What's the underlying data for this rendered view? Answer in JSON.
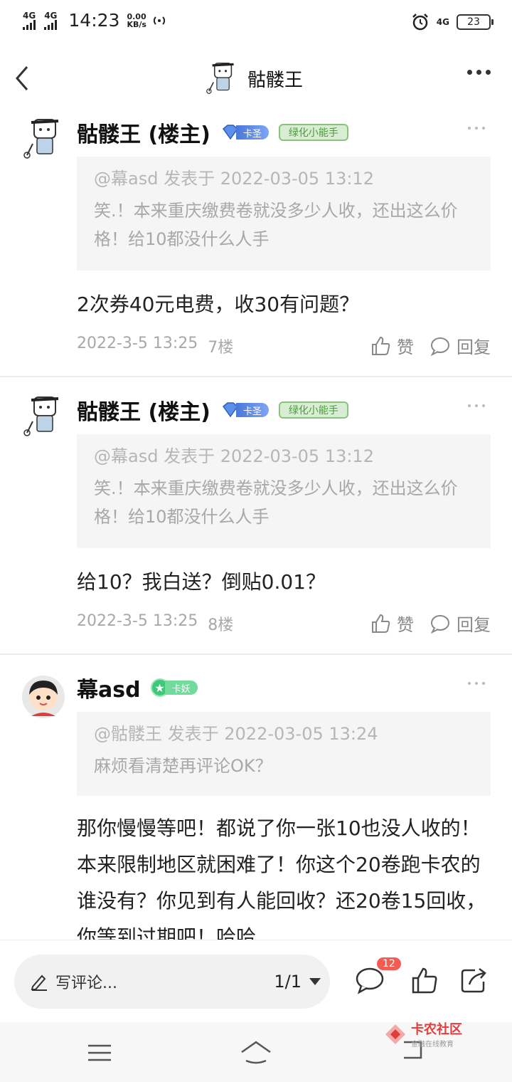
{
  "status_bar": {
    "signal1": "4G",
    "signal2": "4G",
    "time": "14:23",
    "speed_value": "0.00",
    "speed_unit": "KB/s",
    "network": "4G",
    "battery": "23"
  },
  "header": {
    "title": "骷髅王"
  },
  "posts": [
    {
      "username": "骷髅王 (楼主)",
      "badge_level": "卡圣",
      "badge_title": "绿化小能手",
      "quote_meta": "@幕asd 发表于 2022-03-05 13:12",
      "quote_text": "笑.！本来重庆缴费卷就没多少人收，还出这么价格！给10都没什么人手",
      "text": "2次券40元电费，收30有问题？",
      "time": "2022-3-5 13:25",
      "floor": "7楼",
      "like_label": "赞",
      "reply_label": "回复"
    },
    {
      "username": "骷髅王 (楼主)",
      "badge_level": "卡圣",
      "badge_title": "绿化小能手",
      "quote_meta": "@幕asd 发表于 2022-03-05 13:12",
      "quote_text": "笑.！本来重庆缴费卷就没多少人收，还出这么价格！给10都没什么人手",
      "text": "给10？我白送？倒贴0.01？",
      "time": "2022-3-5 13:25",
      "floor": "8楼",
      "like_label": "赞",
      "reply_label": "回复"
    },
    {
      "username": "幕asd",
      "badge_level": "卡妖",
      "quote_meta": "@骷髅王 发表于 2022-03-05 13:24",
      "quote_text": "麻烦看清楚再评论OK？",
      "text": "那你慢慢等吧！都说了你一张10也没人收的！本来限制地区就困难了！你这个20卷跑卡农的谁没有？你见到有人能回收？还20卷15回收，你等到过期吧！哈哈"
    }
  ],
  "bottom_bar": {
    "comment_placeholder": "写评论...",
    "page_indicator": "1/1",
    "comment_count": "12"
  },
  "watermark": {
    "title": "卡农社区",
    "subtitle": "金融在线教育"
  }
}
